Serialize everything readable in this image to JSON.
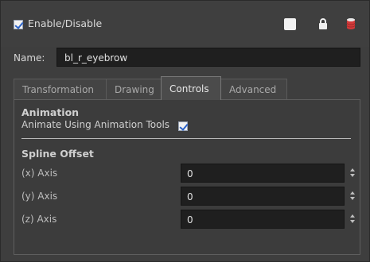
{
  "header": {
    "enable_label": "Enable/Disable",
    "enabled": true,
    "icons": [
      "color-swatch-icon",
      "lock-icon",
      "database-icon"
    ]
  },
  "name": {
    "label": "Name:",
    "value": "bl_r_eyebrow"
  },
  "tabs": [
    {
      "label": "Transformation",
      "active": false
    },
    {
      "label": "Drawing",
      "active": false
    },
    {
      "label": "Controls",
      "active": true
    },
    {
      "label": "Advanced",
      "active": false
    }
  ],
  "animation": {
    "title": "Animation",
    "option_label": "Animate Using Animation Tools",
    "option_checked": true
  },
  "spline_offset": {
    "title": "Spline Offset",
    "axes": [
      {
        "label": "(x) Axis",
        "value": "0"
      },
      {
        "label": "(y) Axis",
        "value": "0"
      },
      {
        "label": "(z) Axis",
        "value": "0"
      }
    ]
  },
  "colors": {
    "background": "#3e3e3e",
    "field_bg": "#1f1f1f",
    "checkbox_check": "#2b62c8",
    "database_icon": "#d23a3a"
  }
}
